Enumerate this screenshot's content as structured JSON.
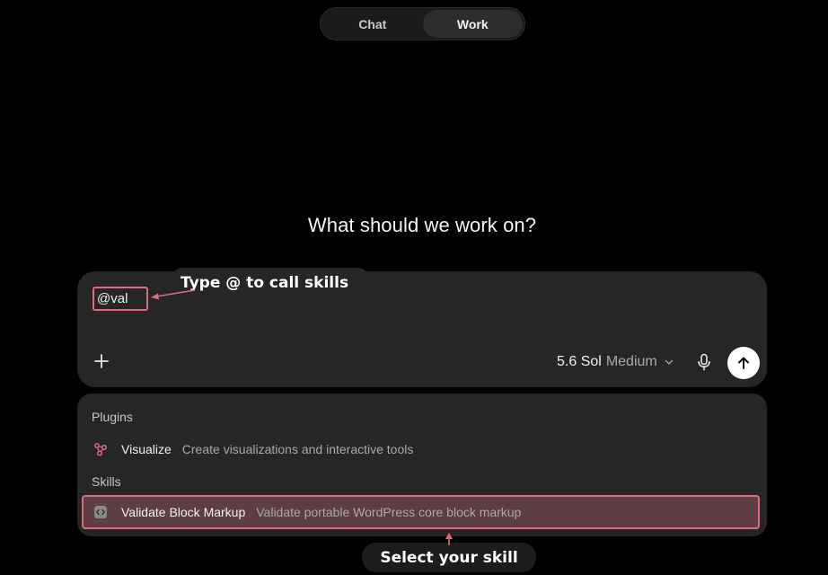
{
  "mode_toggle": {
    "tabs": [
      {
        "label": "Chat",
        "active": false
      },
      {
        "label": "Work",
        "active": true
      }
    ]
  },
  "headline": "What should we work on?",
  "composer": {
    "input_value": "@val",
    "model": {
      "name": "5.6 Sol",
      "effort": "Medium"
    },
    "icons": {
      "add": "plus-icon",
      "model_dropdown": "chevron-down-icon",
      "voice": "microphone-icon",
      "send": "arrow-up-icon"
    }
  },
  "suggestions": {
    "plugins_label": "Plugins",
    "plugins": [
      {
        "title": "Visualize",
        "description": "Create visualizations and interactive tools",
        "icon": "visualize-icon"
      }
    ],
    "skills_label": "Skills",
    "skills": [
      {
        "title": "Validate Block Markup",
        "description": "Validate portable WordPress core block markup",
        "icon": "code-icon",
        "selected": true
      }
    ]
  },
  "annotations": {
    "type_hint": "Type @ to call skills",
    "select_hint": "Select your skill"
  },
  "colors": {
    "background": "#000000",
    "panel": "#262626",
    "annotation_accent": "#e06a7c",
    "selected_row": "#5c3e43",
    "send_button": "#ffffff"
  }
}
